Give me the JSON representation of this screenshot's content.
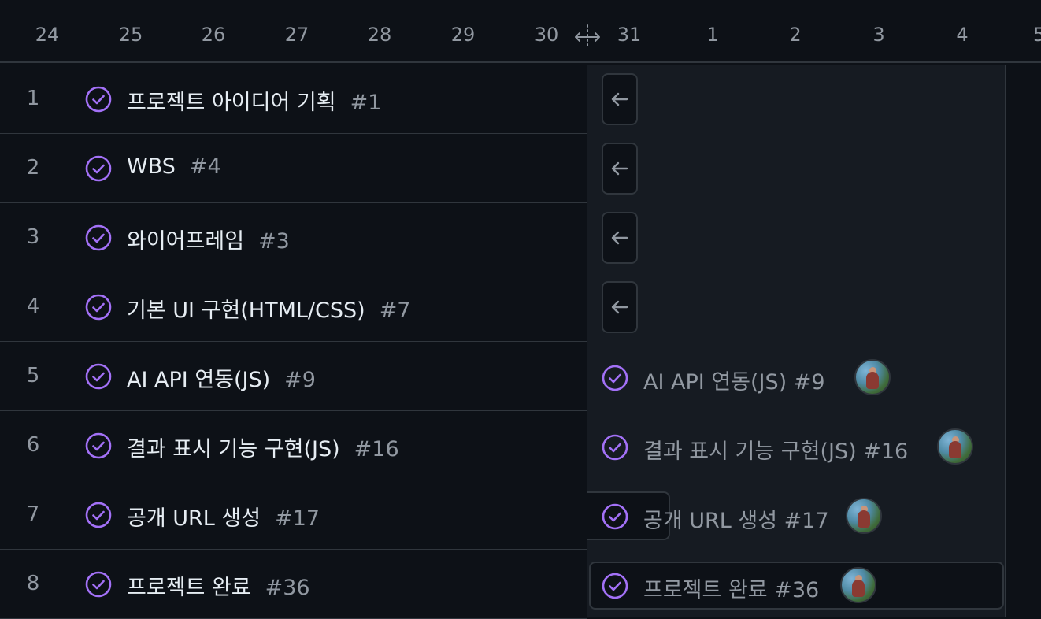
{
  "dates": [
    "24",
    "25",
    "26",
    "27",
    "28",
    "29",
    "30",
    "31",
    "1",
    "2",
    "3",
    "4",
    "5"
  ],
  "rows": [
    {
      "num": "1",
      "title": "프로젝트 아이디어 기획",
      "issue": "#1"
    },
    {
      "num": "2",
      "title": "WBS",
      "issue": "#4"
    },
    {
      "num": "3",
      "title": "와이어프레임",
      "issue": "#3"
    },
    {
      "num": "4",
      "title": "기본 UI 구현(HTML/CSS)",
      "issue": "#7"
    },
    {
      "num": "5",
      "title": "AI API 연동(JS)",
      "issue": "#9"
    },
    {
      "num": "6",
      "title": "결과 표시 기능 구현(JS)",
      "issue": "#16"
    },
    {
      "num": "7",
      "title": "공개 URL 생성",
      "issue": "#17"
    },
    {
      "num": "8",
      "title": "프로젝트 완료",
      "issue": "#36"
    }
  ],
  "bars": [
    {
      "label": "AI API 연동(JS) #9"
    },
    {
      "label": "결과 표시 기능 구현(JS) #16"
    },
    {
      "label": "공개 URL 생성 #17"
    },
    {
      "label": "프로젝트 완료 #36"
    }
  ],
  "icons": {
    "status": "check-circle-icon",
    "nav": "arrow-left-icon",
    "resize": "move-horizontal-icon"
  },
  "colors": {
    "accent": "#a371f7",
    "background": "#0d1117",
    "panel": "#161b22",
    "border": "#30363d"
  }
}
